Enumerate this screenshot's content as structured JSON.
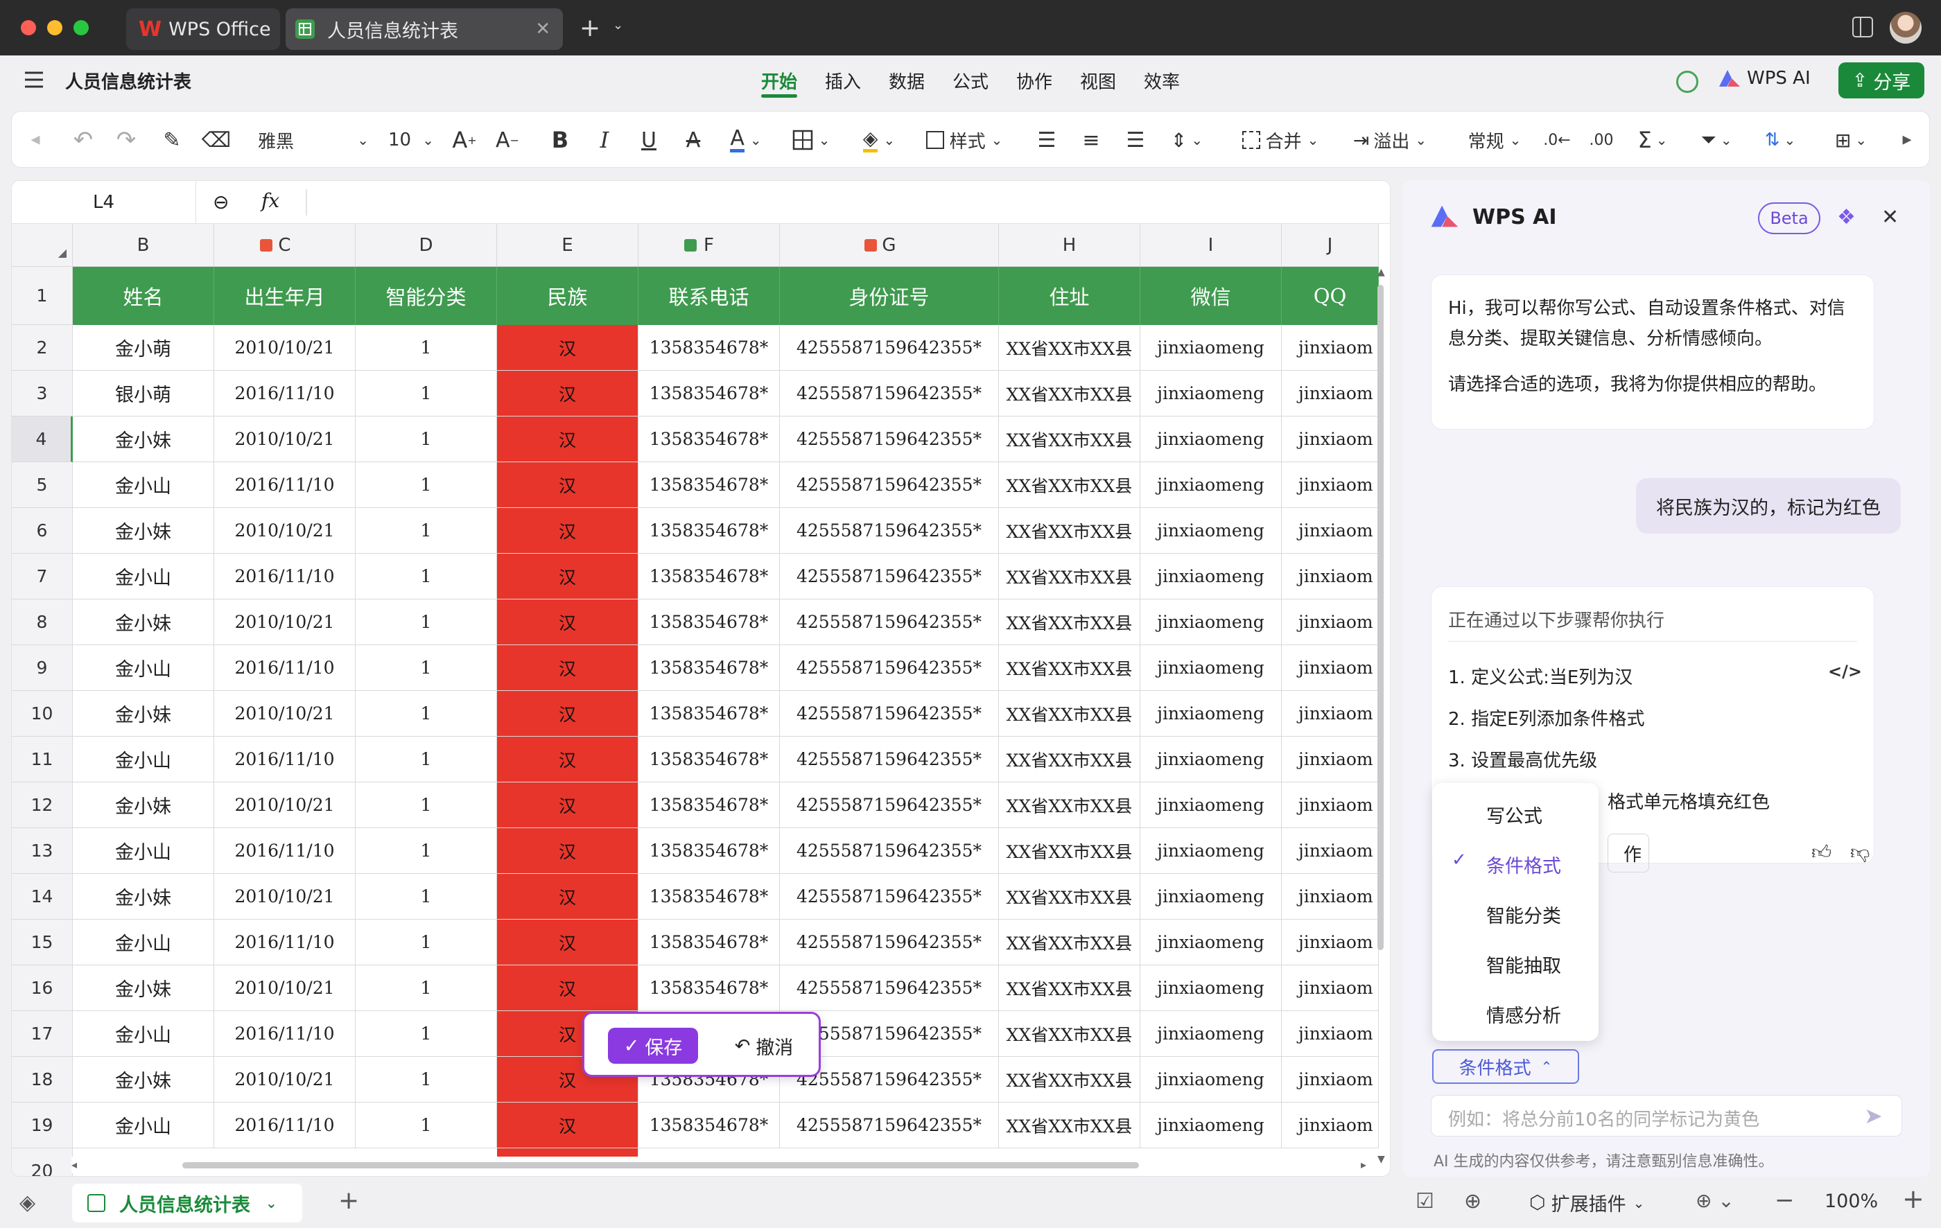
{
  "window": {
    "app_tab": "WPS Office",
    "doc_tab": "人员信息统计表"
  },
  "menubar": {
    "doc_title": "人员信息统计表",
    "menus": [
      "开始",
      "插入",
      "数据",
      "公式",
      "协作",
      "视图",
      "效率"
    ],
    "active_menu": "开始",
    "wps_ai": "WPS AI",
    "share": "分享"
  },
  "toolbar": {
    "font": "雅黑",
    "font_size": "10",
    "style_label": "样式",
    "merge_label": "合并",
    "overflow_label": "溢出",
    "format_label": "常规"
  },
  "formula_bar": {
    "cell_ref": "L4",
    "fx": "fx"
  },
  "sheet": {
    "columns": [
      "B",
      "C",
      "D",
      "E",
      "F",
      "G",
      "H",
      "I",
      "J"
    ],
    "headers": [
      "姓名",
      "出生年月",
      "智能分类",
      "民族",
      "联系电话",
      "身份证号",
      "住址",
      "微信",
      "QQ"
    ],
    "row_numbers": [
      "1",
      "2",
      "3",
      "4",
      "5",
      "6",
      "7",
      "8",
      "9",
      "10",
      "11",
      "12",
      "13",
      "14",
      "15",
      "16",
      "17",
      "18",
      "19",
      "20"
    ],
    "rows": [
      [
        "金小萌",
        "2010/10/21",
        "1",
        "汉",
        "1358354678*",
        "4255587159642355*",
        "XX省XX市XX县",
        "jinxiaomeng",
        "jinxiaom"
      ],
      [
        "银小萌",
        "2016/11/10",
        "1",
        "汉",
        "1358354678*",
        "4255587159642355*",
        "XX省XX市XX县",
        "jinxiaomeng",
        "jinxiaom"
      ],
      [
        "金小妹",
        "2010/10/21",
        "1",
        "汉",
        "1358354678*",
        "4255587159642355*",
        "XX省XX市XX县",
        "jinxiaomeng",
        "jinxiaom"
      ],
      [
        "金小山",
        "2016/11/10",
        "1",
        "汉",
        "1358354678*",
        "4255587159642355*",
        "XX省XX市XX县",
        "jinxiaomeng",
        "jinxiaom"
      ],
      [
        "金小妹",
        "2010/10/21",
        "1",
        "汉",
        "1358354678*",
        "4255587159642355*",
        "XX省XX市XX县",
        "jinxiaomeng",
        "jinxiaom"
      ],
      [
        "金小山",
        "2016/11/10",
        "1",
        "汉",
        "1358354678*",
        "4255587159642355*",
        "XX省XX市XX县",
        "jinxiaomeng",
        "jinxiaom"
      ],
      [
        "金小妹",
        "2010/10/21",
        "1",
        "汉",
        "1358354678*",
        "4255587159642355*",
        "XX省XX市XX县",
        "jinxiaomeng",
        "jinxiaom"
      ],
      [
        "金小山",
        "2016/11/10",
        "1",
        "汉",
        "1358354678*",
        "4255587159642355*",
        "XX省XX市XX县",
        "jinxiaomeng",
        "jinxiaom"
      ],
      [
        "金小妹",
        "2010/10/21",
        "1",
        "汉",
        "1358354678*",
        "4255587159642355*",
        "XX省XX市XX县",
        "jinxiaomeng",
        "jinxiaom"
      ],
      [
        "金小山",
        "2016/11/10",
        "1",
        "汉",
        "1358354678*",
        "4255587159642355*",
        "XX省XX市XX县",
        "jinxiaomeng",
        "jinxiaom"
      ],
      [
        "金小妹",
        "2010/10/21",
        "1",
        "汉",
        "1358354678*",
        "4255587159642355*",
        "XX省XX市XX县",
        "jinxiaomeng",
        "jinxiaom"
      ],
      [
        "金小山",
        "2016/11/10",
        "1",
        "汉",
        "1358354678*",
        "4255587159642355*",
        "XX省XX市XX县",
        "jinxiaomeng",
        "jinxiaom"
      ],
      [
        "金小妹",
        "2010/10/21",
        "1",
        "汉",
        "1358354678*",
        "4255587159642355*",
        "XX省XX市XX县",
        "jinxiaomeng",
        "jinxiaom"
      ],
      [
        "金小山",
        "2016/11/10",
        "1",
        "汉",
        "1358354678*",
        "4255587159642355*",
        "XX省XX市XX县",
        "jinxiaomeng",
        "jinxiaom"
      ],
      [
        "金小妹",
        "2010/10/21",
        "1",
        "汉",
        "1358354678*",
        "4255587159642355*",
        "XX省XX市XX县",
        "jinxiaomeng",
        "jinxiaom"
      ],
      [
        "金小山",
        "2016/11/10",
        "1",
        "汉",
        "",
        "4255587159642355*",
        "XX省XX市XX县",
        "jinxiaomeng",
        "jinxiaom"
      ],
      [
        "金小妹",
        "2010/10/21",
        "1",
        "汉",
        "1358354678*",
        "4255587159642355*",
        "XX省XX市XX县",
        "jinxiaomeng",
        "jinxiaom"
      ],
      [
        "金小山",
        "2016/11/10",
        "1",
        "汉",
        "1358354678*",
        "4255587159642355*",
        "XX省XX市XX县",
        "jinxiaomeng",
        "jinxiaom"
      ]
    ],
    "highlight_color": "#e8352b",
    "header_color": "#3f9b4f"
  },
  "floating_bar": {
    "save": "保存",
    "undo": "撤消"
  },
  "ai_panel": {
    "title": "WPS AI",
    "beta": "Beta",
    "greeting_1": "Hi，我可以帮你写公式、自动设置条件格式、对信息分类、提取关键信息、分析情感倾向。",
    "greeting_2": "请选择合适的选项，我将为你提供相应的帮助。",
    "user_message": "将民族为汉的，标记为红色",
    "steps_title": "正在通过以下步骤帮你执行",
    "steps": [
      "1. 定义公式:当E列为汉",
      "2. 指定E列添加条件格式",
      "3. 设置最高优先级",
      "格式单元格填充红色"
    ],
    "action_fragment": "作",
    "dropdown_options": [
      "写公式",
      "条件格式",
      "智能分类",
      "智能抽取",
      "情感分析"
    ],
    "selected_option": "条件格式",
    "mode_button": "条件格式",
    "input_placeholder": "例如：将总分前10名的同学标记为黄色",
    "disclaimer": "AI 生成的内容仅供参考，请注意甄别信息准确性。"
  },
  "statusbar": {
    "sheet_tab": "人员信息统计表",
    "plugins": "扩展插件",
    "zoom": "100%"
  }
}
